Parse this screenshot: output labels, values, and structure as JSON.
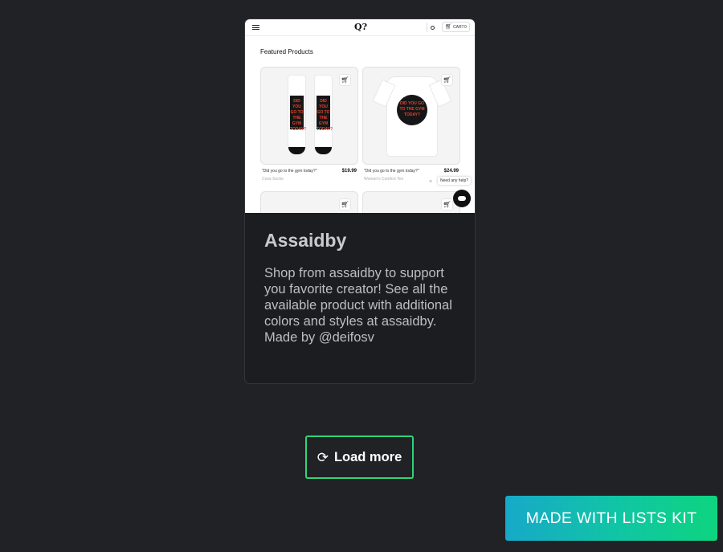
{
  "card": {
    "preview": {
      "logo": "Q?",
      "cart_label": "CART",
      "cart_count": "0",
      "section_title": "Featured Products",
      "products": [
        {
          "name": "\"Did you go to the gym today?\"",
          "price": "$19.99",
          "subtitle": "Crew Socks",
          "image": "socks",
          "print": "DID YOU GO TO THE GYM TODAY?"
        },
        {
          "name": "\"Did you go to the gym today?\"",
          "price": "$24.99",
          "subtitle": "Women's Comfort Tee",
          "image": "t-shirt",
          "print": "DID YOU GO TO THE GYM TODAY?"
        }
      ],
      "help_text": "Need any help?",
      "close_glyph": "×",
      "add_to_cart_icon": "cart-plus-icon",
      "chat_icon": "chat-icon"
    },
    "title": "Assaidby",
    "description": "Shop from assaidby to support you favorite creator! See all the available product with additional colors and styles at assaidby. Made by @deifosv"
  },
  "load_more": {
    "label": "Load more",
    "icon": "refresh-icon",
    "border_color": "#2fd37a"
  },
  "made_with": {
    "label": "MADE WITH LISTS KIT",
    "gradient": [
      "#17a9c9",
      "#0ed47f"
    ]
  },
  "colors": {
    "background": "#202226",
    "card": "#1c1d21"
  }
}
